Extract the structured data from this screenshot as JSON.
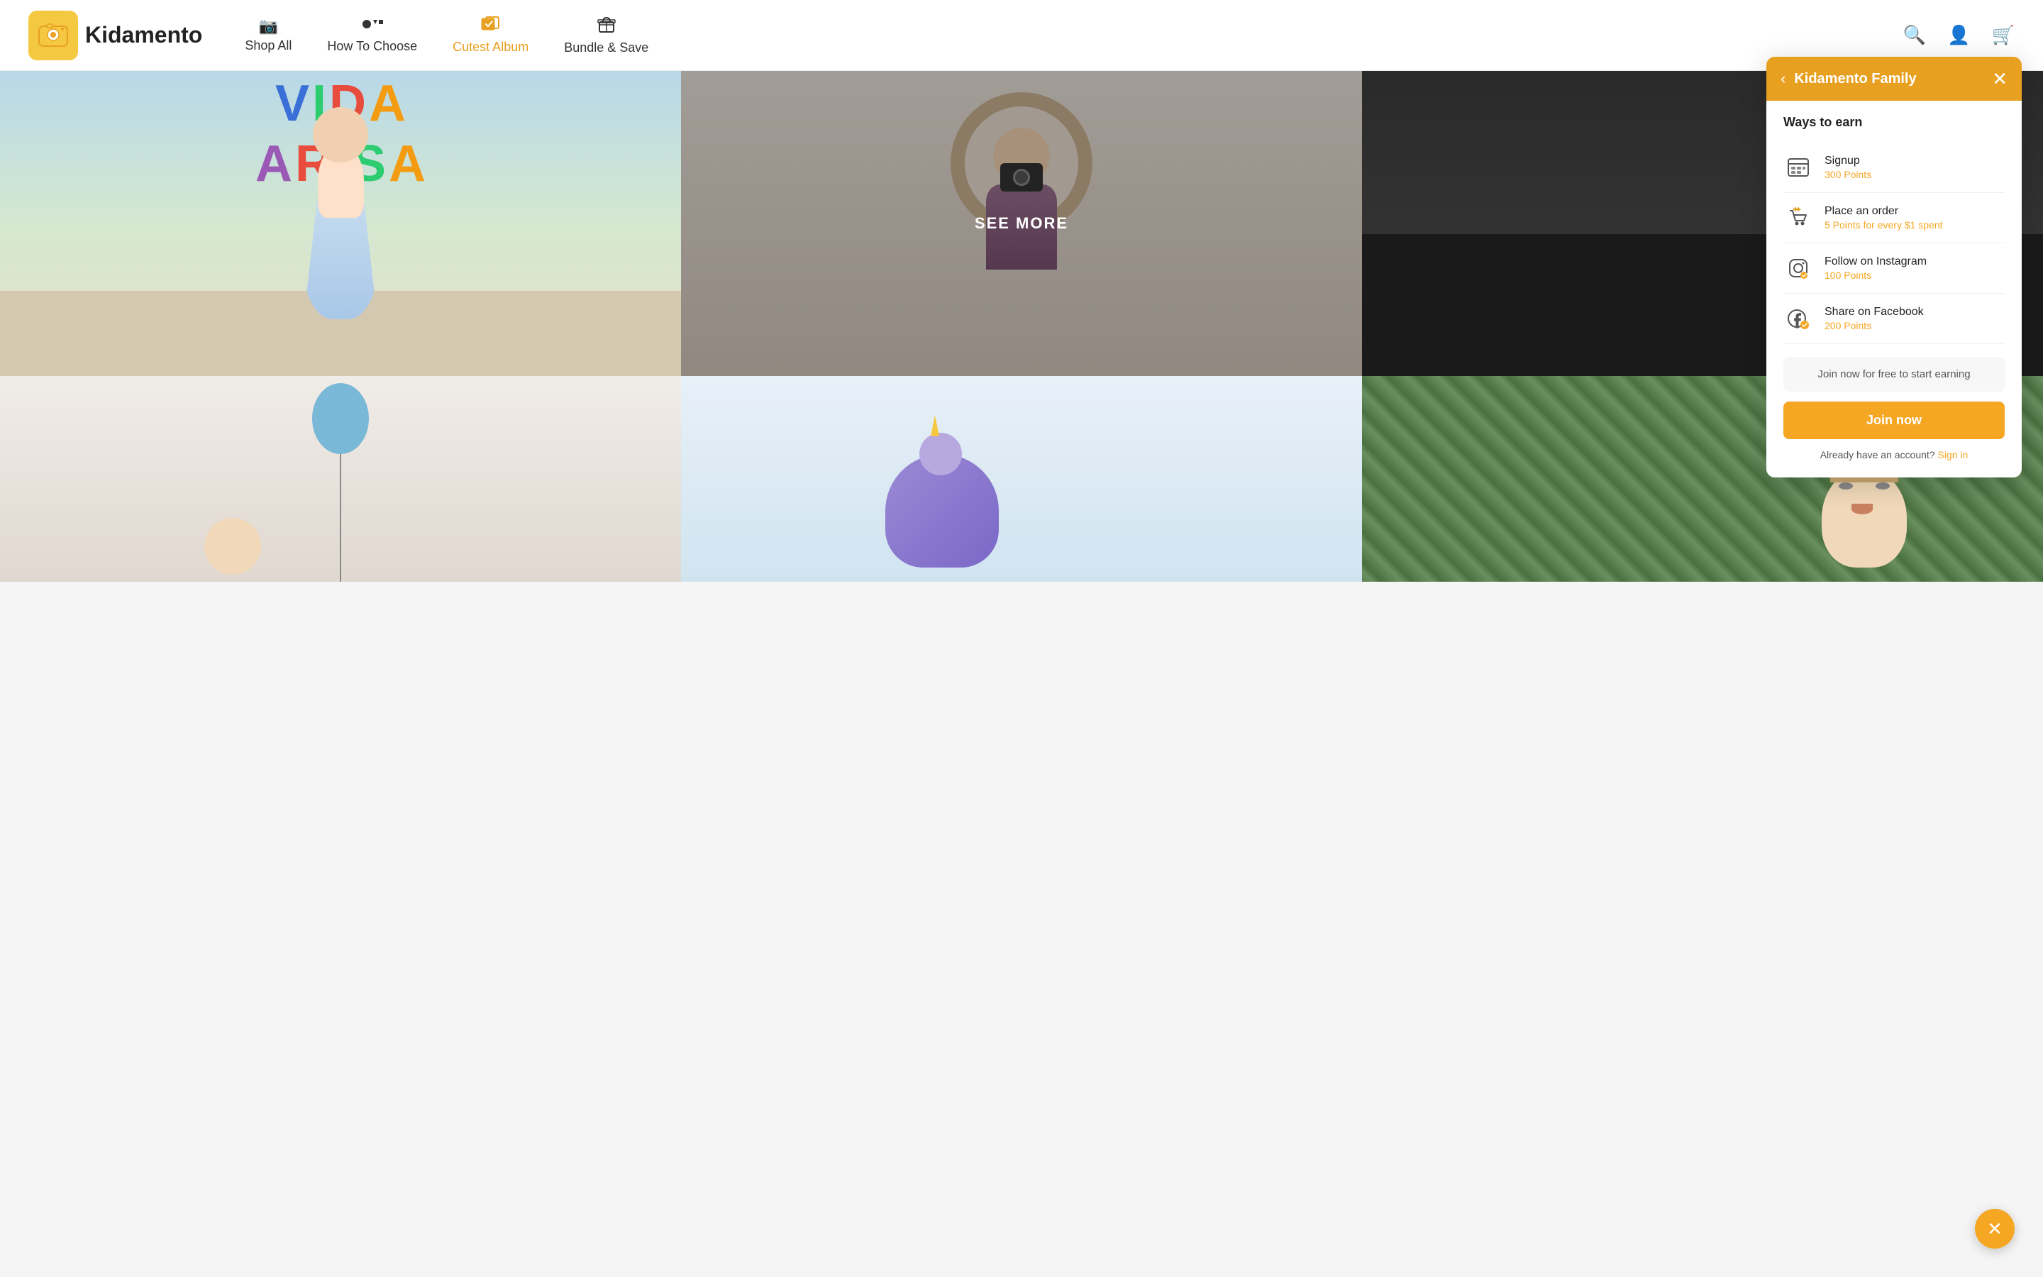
{
  "navbar": {
    "logo_text": "Kidamento",
    "links": [
      {
        "id": "shop-all",
        "icon": "📷",
        "label": "Shop All",
        "active": false
      },
      {
        "id": "how-to-choose",
        "icon": "▲●■",
        "label": "How To Choose",
        "active": false
      },
      {
        "id": "cutest-album",
        "icon": "🃏",
        "label": "Cutest Album",
        "active": true
      },
      {
        "id": "bundle-save",
        "icon": "🎁",
        "label": "Bundle & Save",
        "active": false
      }
    ],
    "search_icon": "🔍",
    "account_icon": "👤",
    "cart_icon": "🛒"
  },
  "photo_grid": {
    "see_more_label": "SEE MORE"
  },
  "panel": {
    "title": "Kidamento Family",
    "ways_title": "Ways to earn",
    "items": [
      {
        "id": "signup",
        "icon": "🏦",
        "label": "Signup",
        "points": "300 Points"
      },
      {
        "id": "place-order",
        "icon": "🛍",
        "label": "Place an order",
        "points": "5 Points for every $1 spent"
      },
      {
        "id": "instagram",
        "icon": "📷",
        "label": "Follow on Instagram",
        "points": "100 Points"
      },
      {
        "id": "facebook",
        "icon": "📘",
        "label": "Share on Facebook",
        "points": "200 Points"
      }
    ],
    "join_banner_text": "Join now for free to start earning",
    "join_button_label": "Join now",
    "account_text": "Already have an account?",
    "sign_in_label": "Sign in"
  }
}
